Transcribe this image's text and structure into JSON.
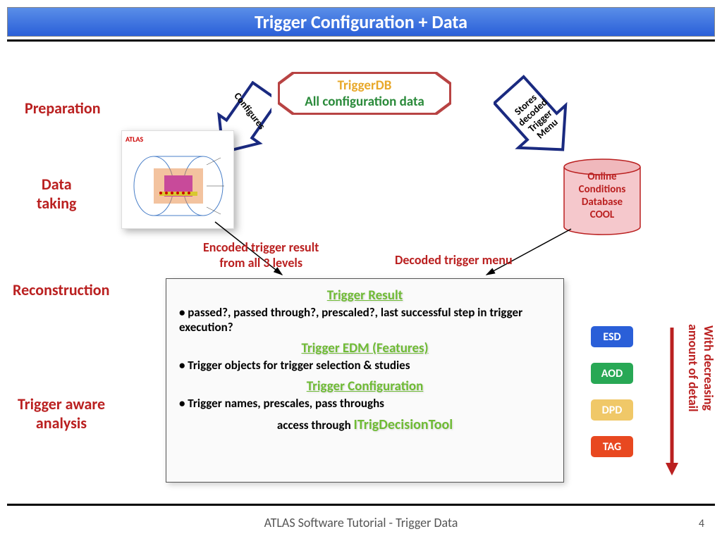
{
  "title": "Trigger Configuration + Data",
  "stages": {
    "preparation": "Preparation",
    "dataTaking": "Data\ntaking",
    "reconstruction": "Reconstruction",
    "triggerAware": "Trigger aware\nanalysis"
  },
  "octagon": {
    "l1": "TriggerDB",
    "l2": "All configuration data"
  },
  "arrows": {
    "configures": "Configures",
    "stores": "Stores\ndecoded\nTrigger\nMenu"
  },
  "atlas": {
    "label": "ATLAS"
  },
  "cool": {
    "l1": "Online",
    "l2": "Conditions",
    "l3": "Database",
    "l4": "COOL"
  },
  "midLabels": {
    "encoded": "Encoded trigger result\nfrom all 3 levels",
    "decoded": "Decoded trigger menu"
  },
  "box": {
    "h1": "Trigger Result",
    "b1": "• passed?, passed through?,  prescaled?, last successful step in trigger execution?",
    "h2": "Trigger EDM (Features)",
    "b2": "• Trigger objects for trigger selection & studies",
    "h3": "Trigger Configuration",
    "b3": "• Trigger names, prescales, pass throughs",
    "access": "access through ",
    "tool": "ITrigDecisionTool"
  },
  "formats": [
    {
      "label": "ESD",
      "color": "#2a5fd8"
    },
    {
      "label": "AOD",
      "color": "#28a855"
    },
    {
      "label": "DPD",
      "color": "#f0c868"
    },
    {
      "label": "TAG",
      "color": "#e84820"
    }
  ],
  "sideLabel": "With decreasing\namount of detail",
  "footer": "ATLAS Software Tutorial - Trigger Data",
  "pageNum": "4"
}
